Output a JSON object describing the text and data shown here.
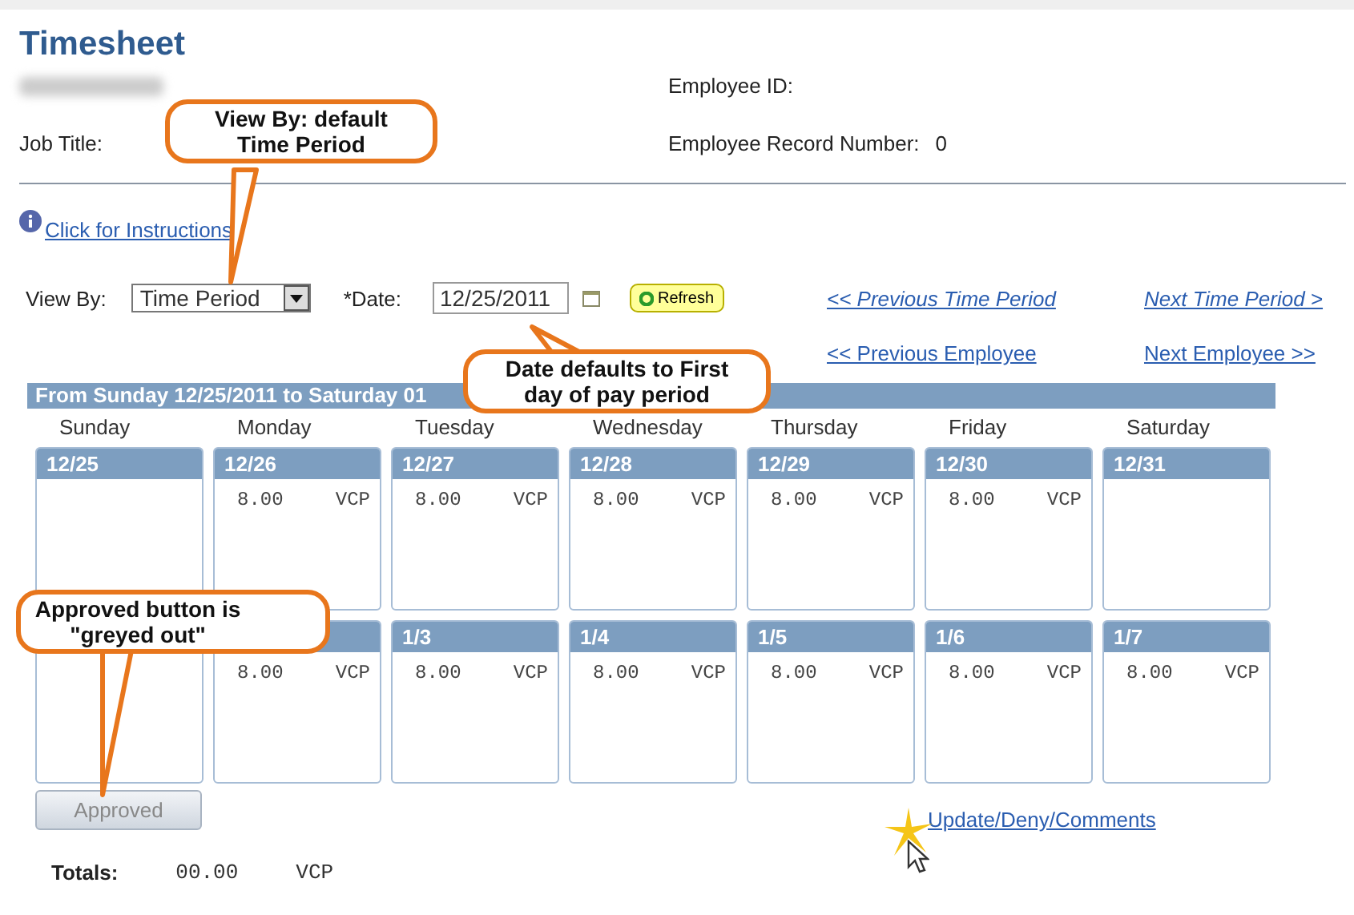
{
  "title": "Timesheet",
  "employee": {
    "job_title_label": "Job Title:",
    "id_label": "Employee ID:",
    "record_label": "Employee Record Number:",
    "record_value": "0"
  },
  "instructions_link": "Click for Instructions",
  "filters": {
    "view_by_label": "View By:",
    "view_by_value": "Time Period",
    "date_label": "*Date:",
    "date_value": "12/25/2011",
    "refresh": "Refresh"
  },
  "nav_links": [
    {
      "label": "<< Previous Time Period",
      "italic": true
    },
    {
      "label": "Next Time Period >",
      "italic": true
    },
    {
      "label": "<< Previous Employee",
      "italic": false
    },
    {
      "label": "Next Employee >>",
      "italic": false
    }
  ],
  "period_header": "From Sunday 12/25/2011 to Saturday 01",
  "day_names": [
    "Sunday",
    "Monday",
    "Tuesday",
    "Wednesday",
    "Thursday",
    "Friday",
    "Saturday"
  ],
  "weeks": [
    [
      {
        "kind": "blank",
        "date": "12/25"
      },
      {
        "kind": "entry",
        "date": "12/26",
        "hours": "8.00",
        "code": "VCP"
      },
      {
        "kind": "entry",
        "date": "12/27",
        "hours": "8.00",
        "code": "VCP"
      },
      {
        "kind": "entry",
        "date": "12/28",
        "hours": "8.00",
        "code": "VCP"
      },
      {
        "kind": "entry",
        "date": "12/29",
        "hours": "8.00",
        "code": "VCP"
      },
      {
        "kind": "entry",
        "date": "12/30",
        "hours": "8.00",
        "code": "VCP"
      },
      {
        "kind": "blank",
        "date": "12/31"
      }
    ],
    [
      {
        "kind": "blank"
      },
      {
        "kind": "entry",
        "hours": "8.00",
        "code": "VCP"
      },
      {
        "kind": "entry",
        "date": "1/3",
        "hours": "8.00",
        "code": "VCP"
      },
      {
        "kind": "entry",
        "date": "1/4",
        "hours": "8.00",
        "code": "VCP"
      },
      {
        "kind": "entry",
        "date": "1/5",
        "hours": "8.00",
        "code": "VCP"
      },
      {
        "kind": "entry",
        "date": "1/6",
        "hours": "8.00",
        "code": "VCP"
      },
      {
        "kind": "entry",
        "date": "1/7",
        "hours": "8.00",
        "code": "VCP"
      }
    ]
  ],
  "approved_button": {
    "label": "Approved",
    "disabled": true
  },
  "update_link": "Update/Deny/Comments",
  "totals": {
    "label": "Totals:",
    "hours": "00.00",
    "code": "VCP"
  },
  "callouts": [
    {
      "text": "View By: default\nTime Period"
    },
    {
      "text": "Date defaults to First\nday of pay period"
    },
    {
      "text": "Approved button is\n\"greyed out\""
    }
  ]
}
